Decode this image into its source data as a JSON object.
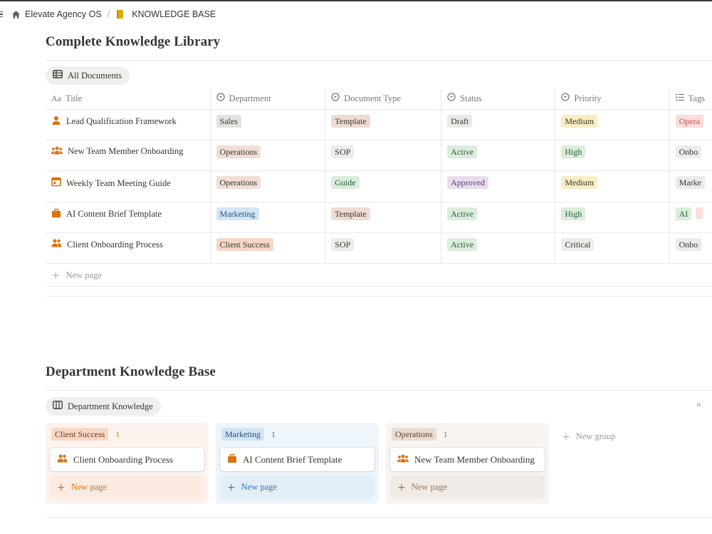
{
  "breadcrumb": {
    "workspace": "Elevate Agency OS",
    "page": "KNOWLEDGE BASE",
    "separator": "/"
  },
  "library": {
    "title": "Complete Knowledge Library",
    "view_label": "All Documents",
    "columns": {
      "title": "Title",
      "department": "Department",
      "doc_type": "Document Type",
      "status": "Status",
      "priority": "Priority",
      "tags": "Tags"
    },
    "rows": [
      {
        "icon": "person-icon",
        "title": "Lead Qualification Framework",
        "department": "Sales",
        "doc_type": "Template",
        "status": "Draft",
        "priority": "Medium",
        "tags": [
          "Opera"
        ]
      },
      {
        "icon": "group-icon",
        "title": "New Team Member Onboarding",
        "department": "Operations",
        "doc_type": "SOP",
        "status": "Active",
        "priority": "High",
        "tags": [
          "Onbo"
        ]
      },
      {
        "icon": "calendar-icon",
        "title": "Weekly Team Meeting Guide",
        "department": "Operations",
        "doc_type": "Guide",
        "status": "Approved",
        "priority": "Medium",
        "tags": [
          "Marke"
        ]
      },
      {
        "icon": "briefcase-icon",
        "title": "AI Content Brief Template",
        "department": "Marketing",
        "doc_type": "Template",
        "status": "Active",
        "priority": "High",
        "tags": [
          "AI",
          ""
        ]
      },
      {
        "icon": "people-icon",
        "title": "Client Onboarding Process",
        "department": "Client Success",
        "doc_type": "SOP",
        "status": "Active",
        "priority": "Critical",
        "tags": [
          "Onbo"
        ]
      }
    ],
    "new_page_label": "New page"
  },
  "department_kb": {
    "title": "Department Knowledge Base",
    "view_label": "Department Knowledge",
    "groups": [
      {
        "name": "Client Success",
        "count": "1",
        "card": "Client Onboarding Process",
        "card_icon": "people-icon",
        "new_label": "New page"
      },
      {
        "name": "Marketing",
        "count": "1",
        "card": "AI Content Brief Template",
        "card_icon": "briefcase-icon",
        "new_label": "New page"
      },
      {
        "name": "Operations",
        "count": "1",
        "card": "New Team Member Onboarding",
        "card_icon": "group-icon",
        "new_label": "New page"
      }
    ],
    "new_group_label": "New group"
  },
  "colors": {
    "icon_orange": "#d9730d",
    "tag_sales": "#e3e2e0",
    "tag_operations": "#f1dfd5",
    "tag_marketing": "#d3e5f5",
    "tag_client_success": "#f7d8c6",
    "tag_template": "#eedcd4",
    "tag_sop": "#ececea",
    "tag_guide": "#dbeddb",
    "tag_draft": "#e9e9e7",
    "tag_active": "#dbeddb",
    "tag_approved": "#e8deee",
    "tag_medium": "#f9edc3",
    "tag_high": "#dbeddb",
    "tag_critical": "#ececea",
    "tag_opera": "#fcdcdc"
  }
}
